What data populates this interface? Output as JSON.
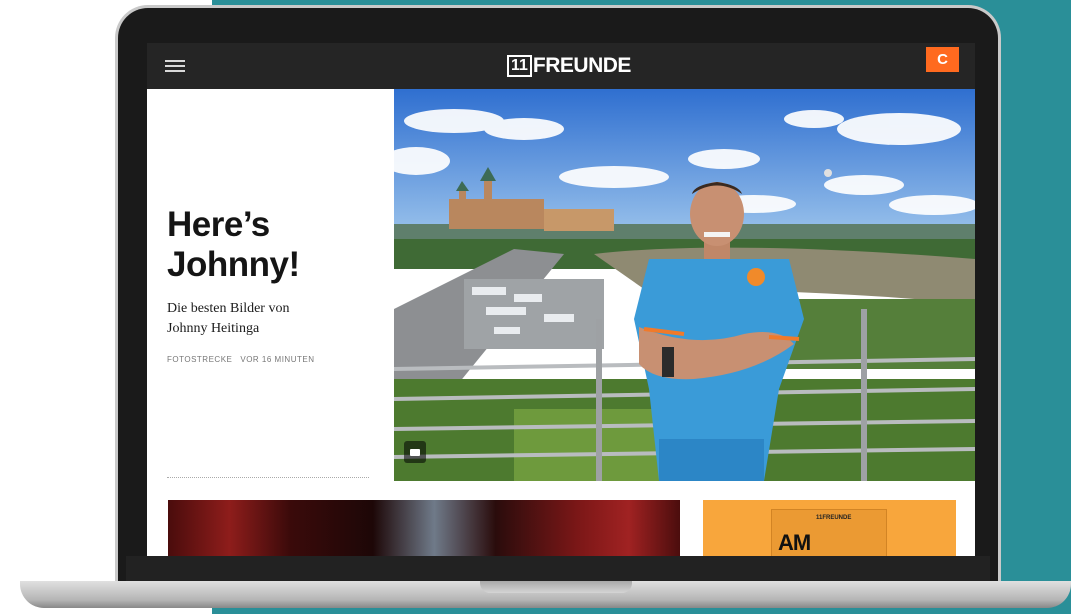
{
  "site": {
    "logo_number": "11",
    "logo_word": "FREUNDE",
    "c_badge": "C"
  },
  "hero": {
    "headline_line1": "Here’s",
    "headline_line2": "Johnny!",
    "subline_line1": "Die besten Bilder von",
    "subline_line2": "Johnny Heitinga",
    "category": "FOTOSTRECKE",
    "time": "VOR 16 MINUTEN"
  },
  "teasers": {
    "magazine_brand": "11FREUNDE",
    "magazine_title": "AM"
  },
  "colors": {
    "backdrop": "#2a8f98",
    "topbar": "#252525",
    "accent": "#ff6a1f",
    "magazine": "#f8a63c"
  },
  "icons": [
    "hamburger-menu-icon",
    "gallery-icon"
  ]
}
